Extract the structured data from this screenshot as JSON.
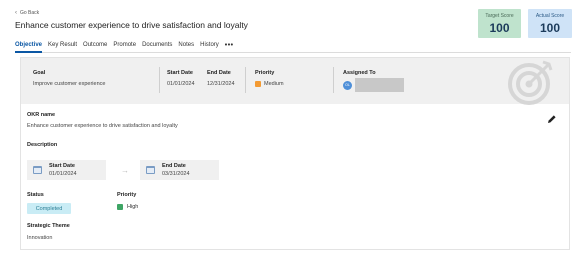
{
  "back": {
    "label": "Go Back"
  },
  "page": {
    "title": "Enhance customer experience to drive satisfaction and loyalty"
  },
  "scores": {
    "target": {
      "label": "Target Score",
      "value": "100"
    },
    "actual": {
      "label": "Actual Score",
      "value": "100"
    }
  },
  "tabs": [
    {
      "label": "Objective",
      "active": true
    },
    {
      "label": "Key Result"
    },
    {
      "label": "Outcome"
    },
    {
      "label": "Promote"
    },
    {
      "label": "Documents"
    },
    {
      "label": "Notes"
    },
    {
      "label": "History"
    },
    {
      "label": "•••"
    }
  ],
  "summary": {
    "goal_label": "Goal",
    "goal_value": "Improve customer experience",
    "start_label": "Start Date",
    "start_value": "01/01/2024",
    "end_label": "End Date",
    "end_value": "12/31/2024",
    "priority_label": "Priority",
    "priority_value": "Medium",
    "assigned_label": "Assigned To",
    "avatar_initials": "OL"
  },
  "details": {
    "okr_name_label": "OKR name",
    "okr_name_value": "Enhance customer experience to drive satisfaction and loyalty",
    "description_label": "Description",
    "start_label": "Start Date",
    "start_value": "01/01/2024",
    "end_label": "End Date",
    "end_value": "03/31/2024",
    "arrow": "→",
    "status_label": "Status",
    "status_value": "Completed",
    "priority_label": "Priority",
    "priority_value": "High",
    "theme_label": "Strategic Theme",
    "theme_value": "Innovation"
  },
  "colors": {
    "accent": "#0b57a4",
    "target_bg": "#bfe3cd",
    "actual_bg": "#cfe3f7",
    "medium": "#f39a32",
    "high": "#3ea565",
    "completed_bg": "#c9ecf5"
  },
  "icons": [
    "chevron-left-icon",
    "target-icon",
    "edit-pencil-icon",
    "calendar-icon",
    "arrow-right-icon",
    "priority-square-icon"
  ]
}
